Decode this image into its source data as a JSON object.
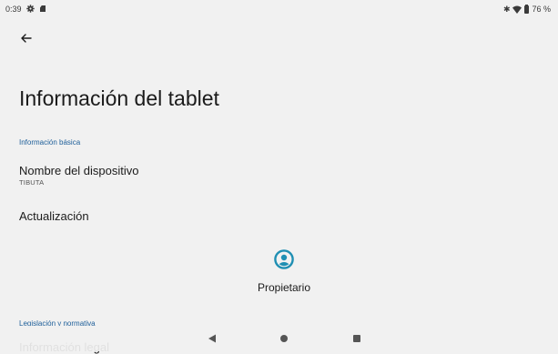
{
  "status_bar": {
    "time": "0:39",
    "icons": [
      "gear-icon",
      "sd-card-icon",
      "bluetooth-icon",
      "wifi-icon",
      "battery-icon"
    ],
    "battery_percent": "76 %"
  },
  "header": {
    "back_icon": "arrow-back-icon"
  },
  "page": {
    "title": "Información del tablet"
  },
  "sections": [
    {
      "header": "Información básica",
      "items": [
        {
          "title": "Nombre del dispositivo",
          "summary": "TIBUTA"
        },
        {
          "title": "Actualización"
        }
      ]
    },
    {
      "header": "Legislación y normativa",
      "items": [
        {
          "title": "Información legal"
        }
      ]
    }
  ],
  "owner": {
    "icon": "account-circle-icon",
    "label": "Propietario"
  },
  "nav_bar": {
    "buttons": [
      "nav-back-icon",
      "nav-home-icon",
      "nav-recents-icon"
    ]
  },
  "colors": {
    "background": "#f1f1f1",
    "accent": "#1d5e99",
    "avatar": "#1f8fb3"
  }
}
